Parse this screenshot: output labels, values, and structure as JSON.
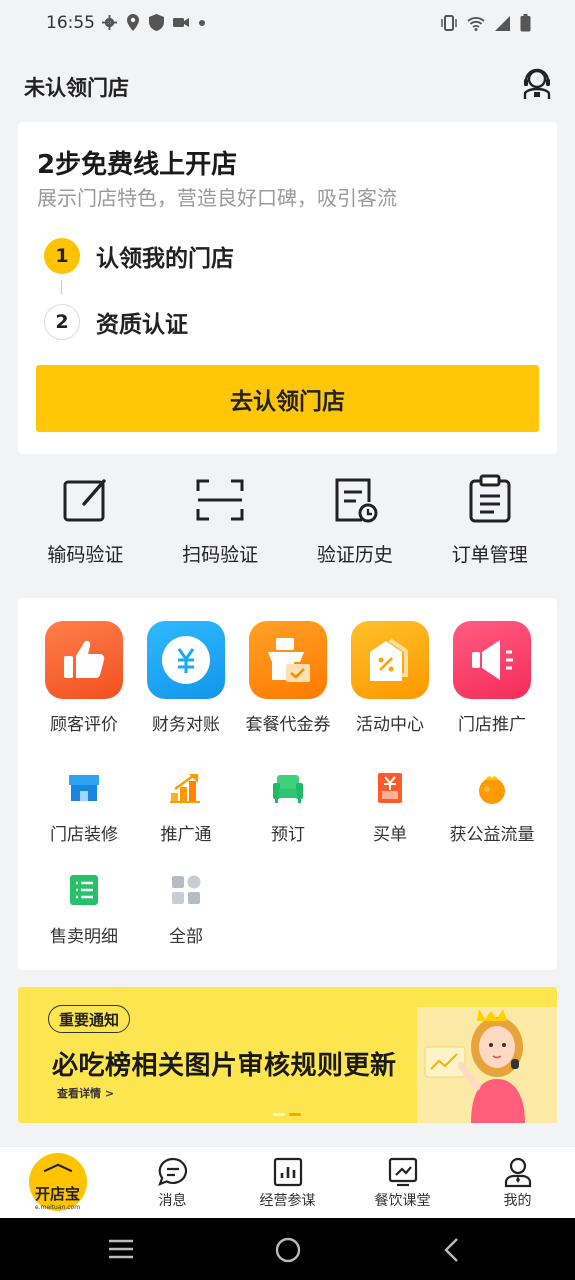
{
  "status": {
    "time": "16:55"
  },
  "header": {
    "title": "未认领门店",
    "support_icon": "customer-service-icon"
  },
  "claim": {
    "title": "2步免费线上开店",
    "subtitle": "展示门店特色，营造良好口碑，吸引客流",
    "steps": [
      {
        "num": "1",
        "label": "认领我的门店"
      },
      {
        "num": "2",
        "label": "资质认证"
      }
    ],
    "button": "去认领门店",
    "accent": "#ffc708"
  },
  "quick_actions": [
    {
      "label": "输码验证",
      "icon": "edit-code-icon"
    },
    {
      "label": "扫码验证",
      "icon": "scan-icon"
    },
    {
      "label": "验证历史",
      "icon": "history-doc-icon"
    },
    {
      "label": "订单管理",
      "icon": "clipboard-icon"
    }
  ],
  "services": {
    "primary": [
      {
        "label": "顾客评价",
        "icon": "thumbs-up-icon",
        "color": "#f9622f"
      },
      {
        "label": "财务对账",
        "icon": "coin-icon",
        "color": "#1ba7f2"
      },
      {
        "label": "套餐代金券",
        "icon": "voucher-icon",
        "color": "#ff8c00"
      },
      {
        "label": "活动中心",
        "icon": "discount-tag-icon",
        "color": "#ffa300"
      },
      {
        "label": "门店推广",
        "icon": "megaphone-icon",
        "color": "#fb3f68"
      }
    ],
    "secondary": [
      {
        "label": "门店装修",
        "icon": "store-icon"
      },
      {
        "label": "推广通",
        "icon": "growth-chart-icon"
      },
      {
        "label": "预订",
        "icon": "sofa-icon"
      },
      {
        "label": "买单",
        "icon": "bill-icon"
      },
      {
        "label": "获公益流量",
        "icon": "orange-icon"
      }
    ],
    "tertiary": [
      {
        "label": "售卖明细",
        "icon": "list-icon"
      },
      {
        "label": "全部",
        "icon": "grid-icon"
      }
    ]
  },
  "banner": {
    "tag": "重要通知",
    "title": "必吃榜相关图片审核规则更新",
    "detail": "查看详情 >"
  },
  "tabs": [
    {
      "label": "",
      "icon": "home-logo",
      "logo_text": "开店宝",
      "logo_sub": "e.meituan.com"
    },
    {
      "label": "消息",
      "icon": "message-icon"
    },
    {
      "label": "经营参谋",
      "icon": "bar-chart-icon"
    },
    {
      "label": "餐饮课堂",
      "icon": "course-icon"
    },
    {
      "label": "我的",
      "icon": "profile-icon"
    }
  ]
}
